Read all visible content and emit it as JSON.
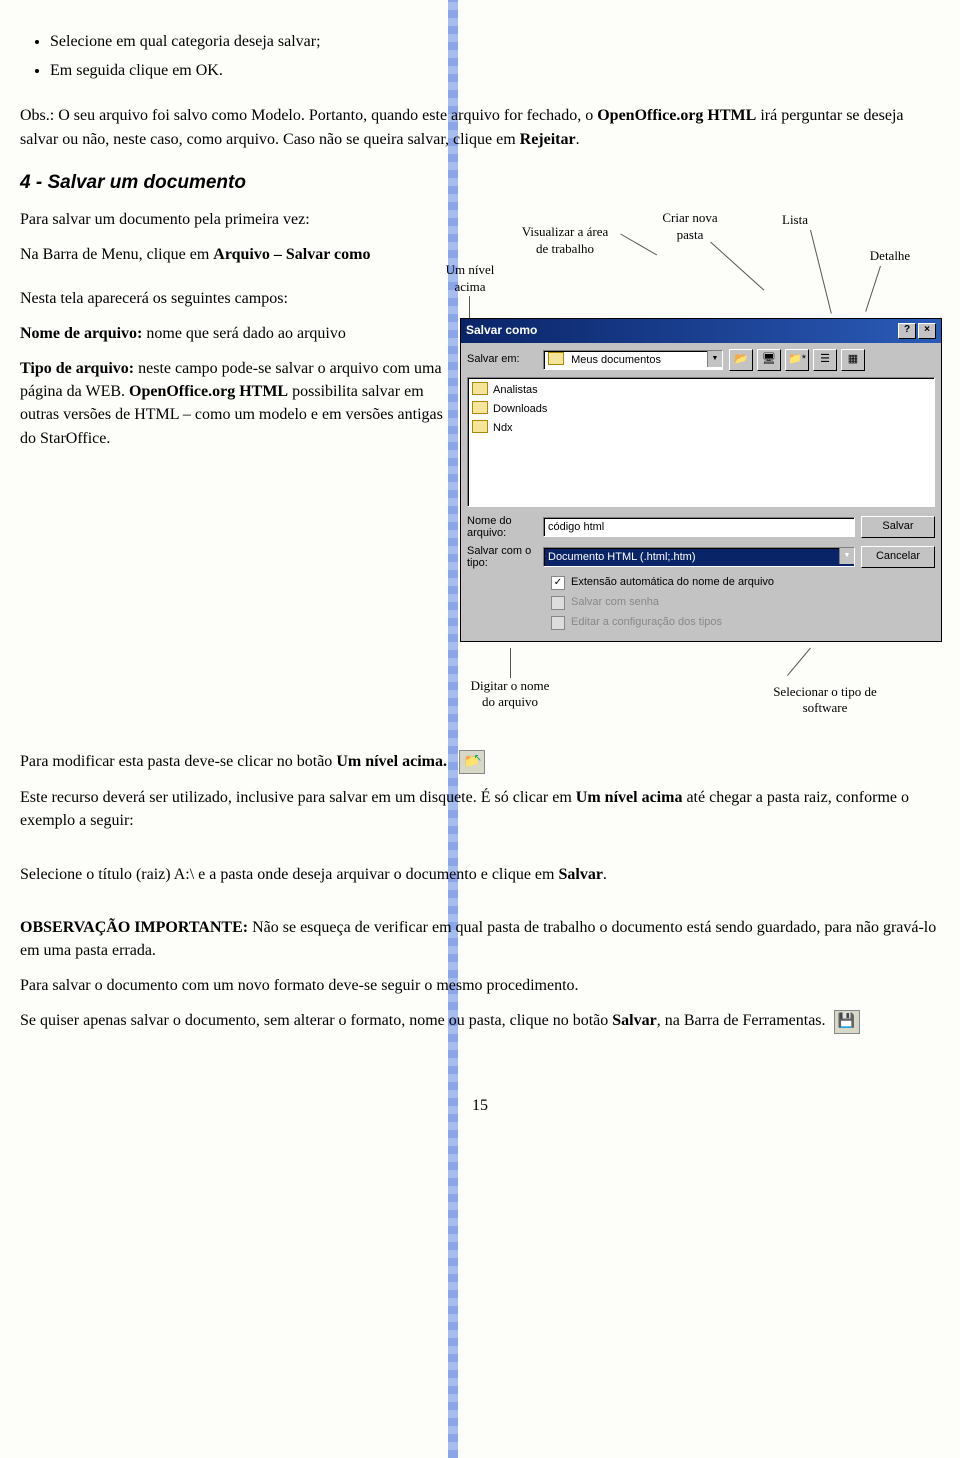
{
  "bullets": [
    "Selecione em qual categoria deseja salvar;",
    "Em seguida clique em OK."
  ],
  "obs": {
    "label": "Obs.:",
    "p1_a": " O seu arquivo foi salvo como Modelo. Portanto, quando este arquivo for fechado, o ",
    "p1_b": "OpenOffice.org HTML",
    "p1_c": " irá perguntar se deseja salvar ou não, neste caso, como arquivo. Caso não se queira salvar, clique em ",
    "p1_d": "Rejeitar",
    "p1_e": "."
  },
  "section4_title": "4 - Salvar um documento",
  "para_first": "Para salvar um documento pela primeira vez:",
  "para_menu_a": "Na Barra de Menu, clique em ",
  "para_menu_b": "Arquivo – Salvar como",
  "para_fields": "Nesta tela aparecerá os seguintes campos:",
  "nome_label": "Nome de arquivo:",
  "nome_text": " nome que será dado ao arquivo",
  "tipo_label": "Tipo de arquivo:",
  "tipo_text_a": " neste campo pode-se salvar o arquivo com uma página da WEB. ",
  "tipo_text_b": "OpenOffice.org HTML",
  "tipo_text_c": " possibilita salvar em outras versões de HTML – como um modelo e em versões antigas do StarOffice.",
  "callouts_top": {
    "um_nivel": "Um nível acima",
    "visualizar": "Visualizar a área de trabalho",
    "criar": "Criar nova pasta",
    "lista": "Lista",
    "detalhe": "Detalhe"
  },
  "dialog": {
    "title": "Salvar como",
    "salvar_em_label": "Salvar em:",
    "salvar_em_value": "Meus documentos",
    "files": [
      "Analistas",
      "Downloads",
      "Ndx"
    ],
    "nome_label": "Nome do arquivo:",
    "nome_value": "código html",
    "tipo_label": "Salvar com o tipo:",
    "tipo_value": "Documento HTML (.html;.htm)",
    "btn_save": "Salvar",
    "btn_cancel": "Cancelar",
    "chk_ext": "Extensão automática do nome de arquivo",
    "chk_pwd": "Salvar com senha",
    "chk_cfg": "Editar a configuração dos tipos"
  },
  "callouts_low": {
    "digitar": "Digitar o nome do arquivo",
    "selecionar": "Selecionar o tipo de software"
  },
  "para_mod_a": "Para modificar esta pasta deve-se clicar no botão ",
  "para_mod_b": "Um nível acima.",
  "para_rec_a": "Este recurso deverá ser utilizado, inclusive para salvar em um disquete. É só clicar em ",
  "para_rec_b": "Um nível acima",
  "para_rec_c": " até chegar a pasta raiz, conforme o exemplo a seguir:",
  "para_sel_a": "Selecione o título (raiz) A:\\ e a pasta onde deseja arquivar o documento e clique em ",
  "para_sel_b": "Salvar",
  "para_sel_c": ".",
  "obs_imp_label": "OBSERVAÇÃO IMPORTANTE:",
  "obs_imp_text": " Não se esqueça de verificar em qual pasta de trabalho o documento está sendo guardado, para não gravá-lo em uma pasta errada.",
  "para_novo": "Para salvar o documento com um novo formato deve-se seguir o mesmo procedimento.",
  "para_quick_a": "Se quiser apenas salvar o documento, sem alterar o formato, nome ou pasta, clique no botão ",
  "para_quick_b": "Salvar",
  "para_quick_c": ", na Barra de Ferramentas.",
  "pagenum": "15"
}
